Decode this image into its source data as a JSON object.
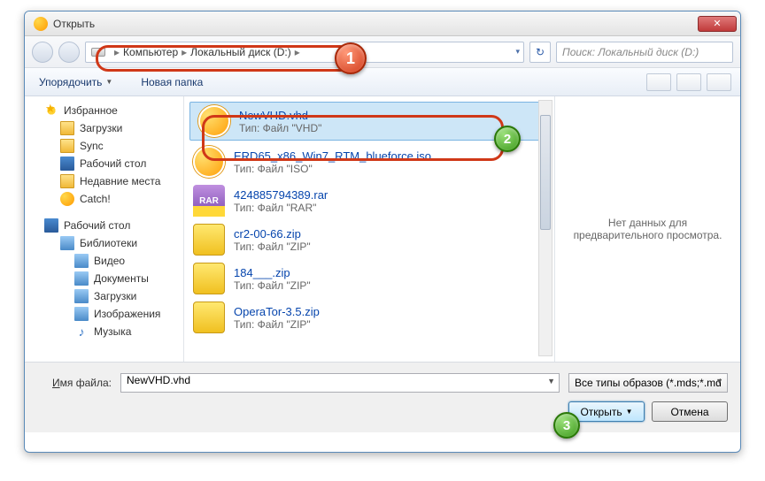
{
  "window": {
    "title": "Открыть",
    "close": "✕"
  },
  "address": {
    "crumbs": [
      "Компьютер",
      "Локальный диск (D:)"
    ],
    "search_placeholder": "Поиск: Локальный диск (D:)"
  },
  "toolbar": {
    "organize": "Упорядочить",
    "newfolder": "Новая папка"
  },
  "sidebar": {
    "favorites": "Избранное",
    "fav_items": [
      "Загрузки",
      "Sync",
      "Рабочий стол",
      "Недавние места",
      "Catch!"
    ],
    "desktop": "Рабочий стол",
    "libraries": "Библиотеки",
    "lib_items": [
      "Видео",
      "Документы",
      "Загрузки",
      "Изображения",
      "Музыка"
    ]
  },
  "files": [
    {
      "name": "NewVHD.vhd",
      "type": "Тип: Файл \"VHD\"",
      "icon": "daemon",
      "selected": true
    },
    {
      "name": "ERD65_x86_Win7_RTM_blueforce.iso",
      "type": "Тип: Файл \"ISO\"",
      "icon": "daemon"
    },
    {
      "name": "424885794389.rar",
      "type": "Тип: Файл \"RAR\"",
      "icon": "rar"
    },
    {
      "name": "cr2-00-66.zip",
      "type": "Тип: Файл \"ZIP\"",
      "icon": "zip"
    },
    {
      "name": "184___.zip",
      "type": "Тип: Файл \"ZIP\"",
      "icon": "zip"
    },
    {
      "name": "OperaTor-3.5.zip",
      "type": "Тип: Файл \"ZIP\"",
      "icon": "zip"
    }
  ],
  "preview": {
    "empty": "Нет данных для предварительного просмотра."
  },
  "footer": {
    "filename_label": "Имя файла:",
    "filename_value": "NewVHD.vhd",
    "filetype": "Все типы образов (*.mds;*.md",
    "open": "Открыть",
    "cancel": "Отмена"
  },
  "callouts": {
    "c1": "1",
    "c2": "2",
    "c3": "3"
  }
}
